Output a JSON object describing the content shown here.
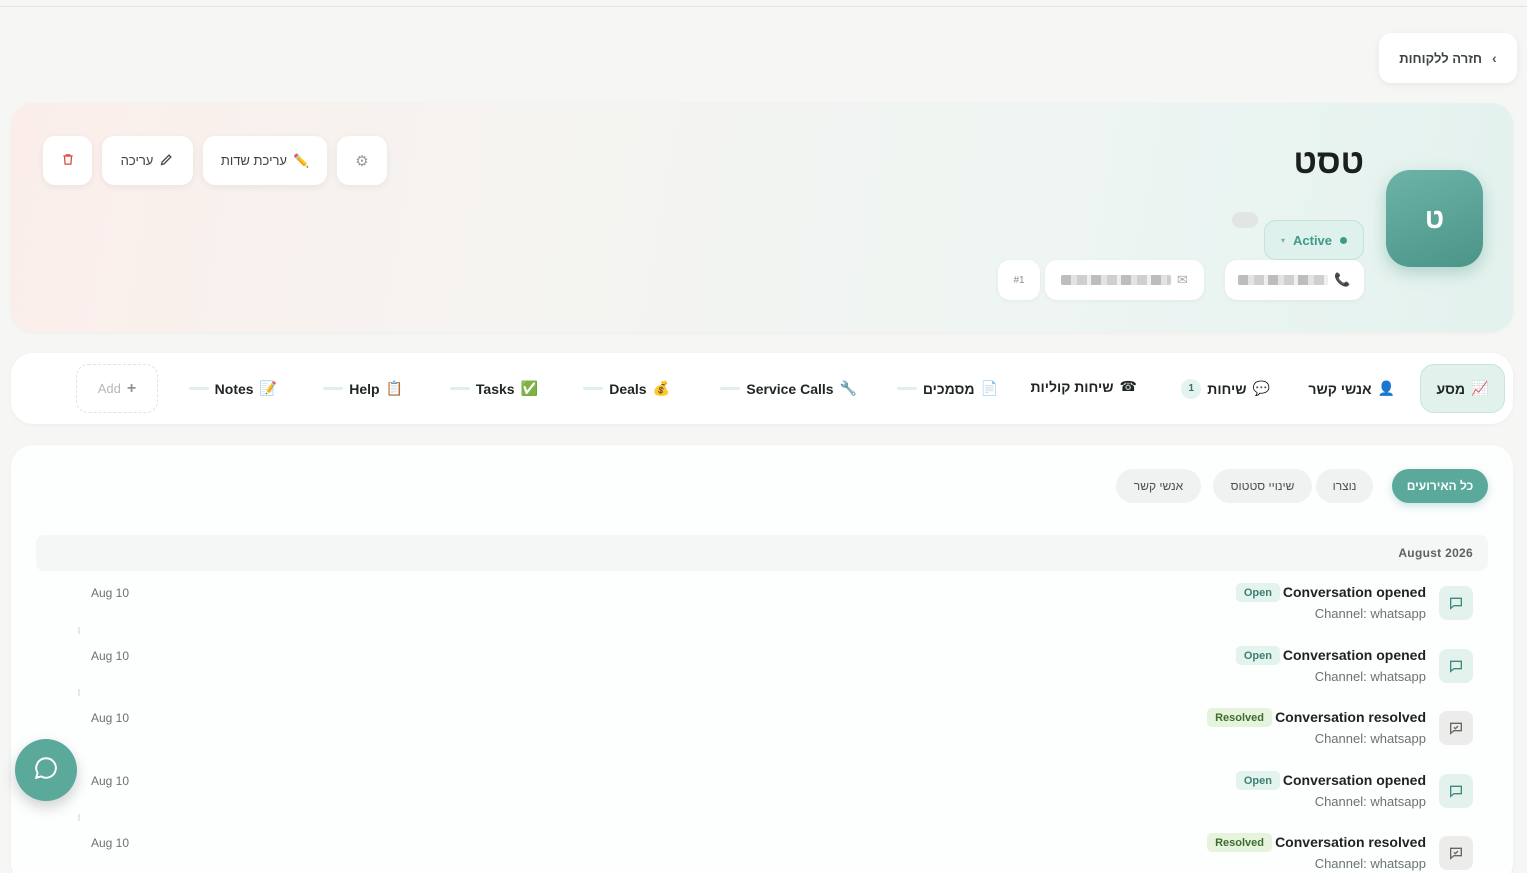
{
  "header": {
    "back_label": "חזרה ללקוחות"
  },
  "profile": {
    "avatar_letter": "ט",
    "name": "טסט",
    "status": "Active",
    "id_label": "#1",
    "actions": {
      "edit_fields": "עריכת שדות",
      "edit": "עריכה"
    }
  },
  "tabs": {
    "items": [
      {
        "label": "מסע",
        "icon": "📈"
      },
      {
        "label": "אנשי קשר",
        "icon": "👤"
      },
      {
        "label": "שיחות",
        "icon": "💬",
        "count": "1"
      },
      {
        "label": "שיחות קוליות",
        "icon": "☎"
      },
      {
        "label": "מסמכים",
        "icon": "📄"
      },
      {
        "label": "Service Calls",
        "icon": "🔧"
      },
      {
        "label": "Deals",
        "icon": "💰"
      },
      {
        "label": "Tasks",
        "icon": "✅"
      },
      {
        "label": "Help",
        "icon": "📋"
      },
      {
        "label": "Notes",
        "icon": "📝"
      }
    ],
    "add_label": "Add"
  },
  "timeline": {
    "filters": [
      "כל האירועים",
      "נוצרו",
      "שינויי סטטוס",
      "אנשי קשר"
    ],
    "month": "August 2026",
    "events": [
      {
        "title": "Conversation opened",
        "badge": "Open",
        "sub": "Channel: whatsapp",
        "date": "Aug 10"
      },
      {
        "title": "Conversation opened",
        "badge": "Open",
        "sub": "Channel: whatsapp",
        "date": "Aug 10"
      },
      {
        "title": "Conversation resolved",
        "badge": "Resolved",
        "sub": "Channel: whatsapp",
        "date": "Aug 10"
      },
      {
        "title": "Conversation opened",
        "badge": "Open",
        "sub": "Channel: whatsapp",
        "date": "Aug 10"
      },
      {
        "title": "Conversation resolved",
        "badge": "Resolved",
        "sub": "Channel: whatsapp",
        "date": "Aug 10"
      }
    ]
  },
  "colors": {
    "accent": "#5aa99b",
    "avatar": "#5a9f94",
    "delete": "#d9493a"
  }
}
